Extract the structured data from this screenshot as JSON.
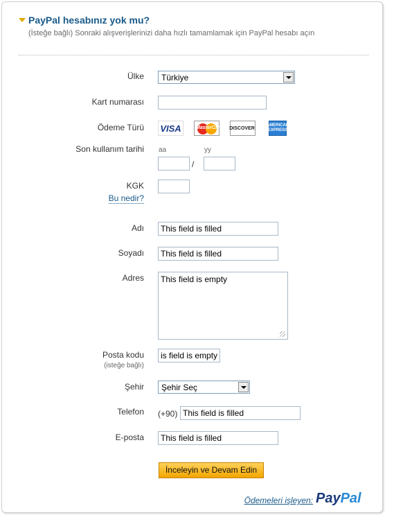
{
  "header": {
    "title": "PayPal hesabınız yok mu?",
    "subtitle": "(İsteğe bağlı) Sonraki alışverişlerinizi daha hızlı tamamlamak için PayPal hesabı açın"
  },
  "form": {
    "country": {
      "label": "Ülke",
      "value": "Türkiye"
    },
    "card_number": {
      "label": "Kart numarası",
      "value": ""
    },
    "payment_type": {
      "label": "Ödeme Türü",
      "cards": {
        "visa": "VISA",
        "mastercard": "MasterCard",
        "discover": "DISCOVER",
        "amex": "AMERICAN EXPRESS"
      }
    },
    "expiry": {
      "label": "Son kullanım tarihi",
      "month_hint": "aa",
      "year_hint": "yy",
      "separator": "/",
      "month": "",
      "year": ""
    },
    "cvv": {
      "label": "KGK",
      "help_link": "Bu nedir?",
      "value": ""
    },
    "first_name": {
      "label": "Adı",
      "value": "This field is filled"
    },
    "last_name": {
      "label": "Soyadı",
      "value": "This field is filled"
    },
    "address": {
      "label": "Adres",
      "value": "This field is empty"
    },
    "postal_code": {
      "label": "Posta kodu",
      "sublabel": "(isteğe bağlı)",
      "value": "is field is empty"
    },
    "city": {
      "label": "Şehir",
      "value": "Şehir Seç"
    },
    "phone": {
      "label": "Telefon",
      "prefix": "(+90)",
      "value": "This field is filled"
    },
    "email": {
      "label": "E-posta",
      "value": "This field is filled"
    }
  },
  "submit_label": "İnceleyin ve Devam Edin",
  "footer": {
    "processed_by": "Ödemeleri işleyen:",
    "logo_part1": "Pay",
    "logo_part2": "Pal"
  }
}
